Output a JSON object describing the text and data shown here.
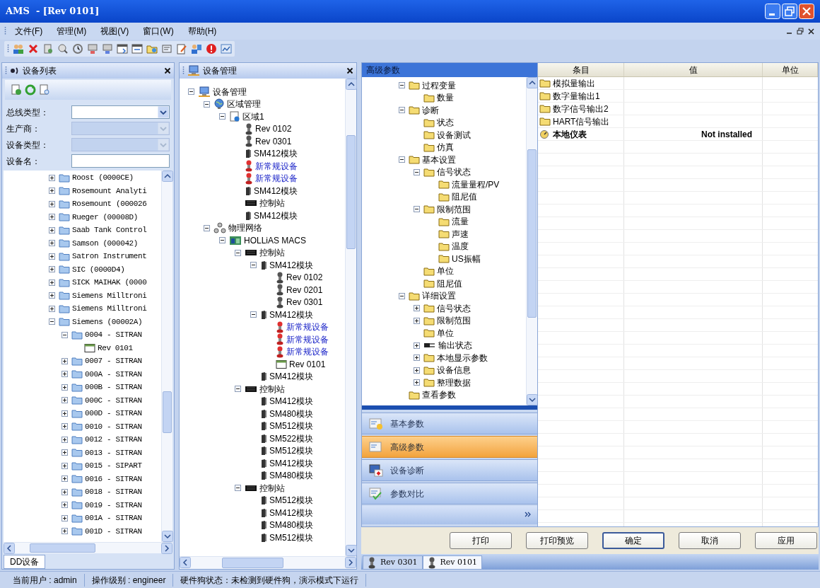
{
  "window": {
    "title": "AMS  - [Rev 0101]"
  },
  "menu": [
    "文件(F)",
    "管理(M)",
    "视图(V)",
    "窗口(W)",
    "帮助(H)"
  ],
  "device_list": {
    "title": "设备列表",
    "filters": [
      {
        "label": "总线类型：",
        "kind": "dropdown",
        "disabled": false
      },
      {
        "label": "生产商：",
        "kind": "dropdown",
        "disabled": true
      },
      {
        "label": "设备类型：",
        "kind": "dropdown",
        "disabled": true
      },
      {
        "label": "设备名：",
        "kind": "text"
      }
    ],
    "tree": [
      {
        "label": "Roost (0000CE)",
        "kind": "folder-blue",
        "expanded": false
      },
      {
        "label": "Rosemount Analyti",
        "kind": "folder-blue",
        "expanded": false
      },
      {
        "label": "Rosemount (000026",
        "kind": "folder-blue",
        "expanded": false
      },
      {
        "label": "Rueger (00008D)",
        "kind": "folder-blue",
        "expanded": false
      },
      {
        "label": "Saab Tank Control",
        "kind": "folder-blue",
        "expanded": false
      },
      {
        "label": "Samson (000042)",
        "kind": "folder-blue",
        "expanded": false
      },
      {
        "label": "Satron Instrument",
        "kind": "folder-blue",
        "expanded": false
      },
      {
        "label": "SIC (0000D4)",
        "kind": "folder-blue",
        "expanded": false
      },
      {
        "label": "SICK MAIHAK (0000",
        "kind": "folder-blue",
        "expanded": false
      },
      {
        "label": "Siemens Milltroni",
        "kind": "folder-blue",
        "expanded": false
      },
      {
        "label": "Siemens Milltroni",
        "kind": "folder-blue",
        "expanded": false
      },
      {
        "label": "Siemens (00002A)",
        "kind": "folder-blue",
        "expanded": true,
        "children": [
          {
            "label": "0004 - SITRAN",
            "kind": "folder-blue",
            "expanded": true,
            "children": [
              {
                "label": "Rev 0101",
                "kind": "window"
              }
            ]
          },
          {
            "label": "0007 - SITRAN",
            "kind": "folder-blue",
            "expanded": false
          },
          {
            "label": "000A - SITRAN",
            "kind": "folder-blue",
            "expanded": false
          },
          {
            "label": "000B - SITRAN",
            "kind": "folder-blue",
            "expanded": false
          },
          {
            "label": "000C - SITRAN",
            "kind": "folder-blue",
            "expanded": false
          },
          {
            "label": "000D - SITRAN",
            "kind": "folder-blue",
            "expanded": false
          },
          {
            "label": "0010 - SITRAN",
            "kind": "folder-blue",
            "expanded": false
          },
          {
            "label": "0012 - SITRAN",
            "kind": "folder-blue",
            "expanded": false
          },
          {
            "label": "0013 - SITRAN",
            "kind": "folder-blue",
            "expanded": false
          },
          {
            "label": "0015 - SIPART",
            "kind": "folder-blue",
            "expanded": false
          },
          {
            "label": "0016 - SITRAN",
            "kind": "folder-blue",
            "expanded": false
          },
          {
            "label": "0018 - SITRAN",
            "kind": "folder-blue",
            "expanded": false
          },
          {
            "label": "0019 - SITRAN",
            "kind": "folder-blue",
            "expanded": false
          },
          {
            "label": "001A - SITRAN",
            "kind": "folder-blue",
            "expanded": false
          },
          {
            "label": "001D - SITRAN",
            "kind": "folder-blue",
            "expanded": false
          }
        ]
      }
    ],
    "bottom_tab": "DD设备"
  },
  "device_management": {
    "title": "设备管理",
    "tree": [
      {
        "label": "设备管理",
        "kind": "computer",
        "expanded": true,
        "children": [
          {
            "label": "区域管理",
            "kind": "globe",
            "expanded": true,
            "children": [
              {
                "label": "区域1",
                "kind": "area",
                "expanded": true,
                "children": [
                  {
                    "label": "Rev 0102",
                    "kind": "transmitter"
                  },
                  {
                    "label": "Rev 0301",
                    "kind": "transmitter"
                  },
                  {
                    "label": "SM412模块",
                    "kind": "module"
                  },
                  {
                    "label": "新常规设备",
                    "kind": "new-device"
                  },
                  {
                    "label": "新常规设备",
                    "kind": "new-device"
                  },
                  {
                    "label": "SM412模块",
                    "kind": "module"
                  },
                  {
                    "label": "控制站",
                    "kind": "station"
                  },
                  {
                    "label": "SM412模块",
                    "kind": "module"
                  }
                ]
              }
            ]
          },
          {
            "label": "物理网络",
            "kind": "network",
            "expanded": true,
            "children": [
              {
                "label": "HOLLiAS MACS",
                "kind": "system",
                "expanded": true,
                "children": [
                  {
                    "label": "控制站",
                    "kind": "station",
                    "expanded": true,
                    "children": [
                      {
                        "label": "SM412模块",
                        "kind": "module",
                        "expanded": true,
                        "children": [
                          {
                            "label": "Rev 0102",
                            "kind": "transmitter"
                          },
                          {
                            "label": "Rev 0201",
                            "kind": "transmitter"
                          },
                          {
                            "label": "Rev 0301",
                            "kind": "transmitter"
                          }
                        ]
                      },
                      {
                        "label": "SM412模块",
                        "kind": "module",
                        "expanded": true,
                        "children": [
                          {
                            "label": "新常规设备",
                            "kind": "new-device"
                          },
                          {
                            "label": "新常规设备",
                            "kind": "new-device"
                          },
                          {
                            "label": "新常规设备",
                            "kind": "new-device"
                          },
                          {
                            "label": "Rev 0101",
                            "kind": "window"
                          }
                        ]
                      },
                      {
                        "label": "SM412模块",
                        "kind": "module"
                      }
                    ]
                  },
                  {
                    "label": "控制站",
                    "kind": "station",
                    "expanded": true,
                    "children": [
                      {
                        "label": "SM412模块",
                        "kind": "module"
                      },
                      {
                        "label": "SM480模块",
                        "kind": "module"
                      },
                      {
                        "label": "SM512模块",
                        "kind": "module"
                      },
                      {
                        "label": "SM522模块",
                        "kind": "module"
                      },
                      {
                        "label": "SM512模块",
                        "kind": "module"
                      },
                      {
                        "label": "SM412模块",
                        "kind": "module"
                      },
                      {
                        "label": "SM480模块",
                        "kind": "module"
                      }
                    ]
                  },
                  {
                    "label": "控制站",
                    "kind": "station",
                    "expanded": true,
                    "children": [
                      {
                        "label": "SM512模块",
                        "kind": "module"
                      },
                      {
                        "label": "SM412模块",
                        "kind": "module"
                      },
                      {
                        "label": "SM480模块",
                        "kind": "module"
                      },
                      {
                        "label": "SM512模块",
                        "kind": "module"
                      }
                    ]
                  }
                ]
              }
            ]
          }
        ]
      }
    ]
  },
  "parameters": {
    "title": "高级参数",
    "tree": [
      {
        "label": "过程变量",
        "kind": "folder",
        "expanded": true,
        "children": [
          {
            "label": "数量",
            "kind": "folder"
          }
        ]
      },
      {
        "label": "诊断",
        "kind": "folder",
        "expanded": true,
        "children": [
          {
            "label": "状态",
            "kind": "folder"
          },
          {
            "label": "设备测试",
            "kind": "folder"
          },
          {
            "label": "仿真",
            "kind": "folder"
          }
        ]
      },
      {
        "label": "基本设置",
        "kind": "folder",
        "expanded": true,
        "children": [
          {
            "label": "信号状态",
            "kind": "folder",
            "expanded": true,
            "children": [
              {
                "label": "流量量程/PV",
                "kind": "folder"
              },
              {
                "label": "阻尼值",
                "kind": "folder"
              }
            ]
          },
          {
            "label": "限制范围",
            "kind": "folder",
            "expanded": true,
            "children": [
              {
                "label": "流量",
                "kind": "folder"
              },
              {
                "label": "声速",
                "kind": "folder"
              },
              {
                "label": "温度",
                "kind": "folder"
              },
              {
                "label": "US振幅",
                "kind": "folder"
              }
            ]
          },
          {
            "label": "单位",
            "kind": "folder"
          },
          {
            "label": "阻尼值",
            "kind": "folder"
          }
        ]
      },
      {
        "label": "详细设置",
        "kind": "folder",
        "expanded": true,
        "children": [
          {
            "label": "信号状态",
            "kind": "folder",
            "expanded": false
          },
          {
            "label": "限制范围",
            "kind": "folder",
            "expanded": false
          },
          {
            "label": "单位",
            "kind": "folder"
          },
          {
            "label": "输出状态",
            "kind": "plug",
            "expanded": false
          },
          {
            "label": "本地显示参数",
            "kind": "folder",
            "expanded": false
          },
          {
            "label": "设备信息",
            "kind": "folder",
            "expanded": false
          },
          {
            "label": "整理数据",
            "kind": "folder",
            "expanded": false
          }
        ]
      },
      {
        "label": "查看参数",
        "kind": "folder"
      }
    ],
    "nav": [
      {
        "label": "基本参数",
        "kind": "basic",
        "selected": false
      },
      {
        "label": "高级参数",
        "kind": "advanced",
        "selected": true
      },
      {
        "label": "设备诊断",
        "kind": "diagnosis",
        "selected": false
      },
      {
        "label": "参数对比",
        "kind": "compare",
        "selected": false
      }
    ]
  },
  "table": {
    "columns": [
      "条目",
      "值",
      "单位"
    ],
    "rows": [
      {
        "kind": "folder",
        "item": "模拟量输出"
      },
      {
        "kind": "folder",
        "item": "数字量输出1"
      },
      {
        "kind": "folder",
        "item": "数字信号输出2"
      },
      {
        "kind": "folder",
        "item": "HART信号输出"
      },
      {
        "kind": "instrument",
        "item": "本地仪表",
        "value": "Not installed"
      }
    ]
  },
  "buttons": [
    {
      "label": "打印",
      "focused": false
    },
    {
      "label": "打印预览",
      "focused": false
    },
    {
      "label": "确定",
      "focused": true
    },
    {
      "label": "取消",
      "focused": false
    },
    {
      "label": "应用",
      "focused": false
    }
  ],
  "document_tabs": [
    {
      "label": "Rev 0301",
      "selected": false
    },
    {
      "label": "Rev 0101",
      "selected": true
    }
  ],
  "status_bar": [
    "当前用户 : admin",
    "操作级别 : engineer",
    "硬件狗状态：未检测到硬件狗，演示模式下运行"
  ]
}
